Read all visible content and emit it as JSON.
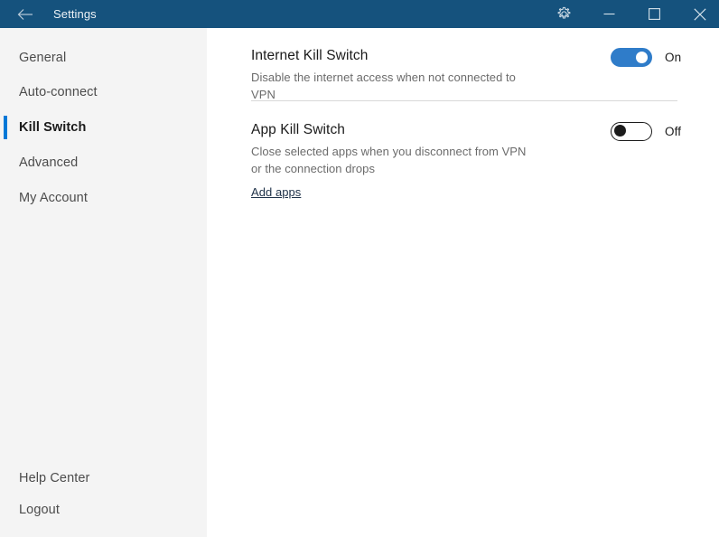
{
  "titlebar": {
    "title": "Settings",
    "back_icon": "back-arrow-icon",
    "gear_icon": "gear-icon",
    "minimize_icon": "minimize-icon",
    "maximize_icon": "maximize-icon",
    "close_icon": "close-icon",
    "background_color": "#15527d"
  },
  "sidebar": {
    "background_color": "#f4f4f4",
    "accent_color": "#0078d7",
    "items": [
      {
        "label": "General",
        "selected": false
      },
      {
        "label": "Auto-connect",
        "selected": false
      },
      {
        "label": "Kill Switch",
        "selected": true
      },
      {
        "label": "Advanced",
        "selected": false
      },
      {
        "label": "My Account",
        "selected": false
      }
    ],
    "bottom_items": [
      {
        "label": "Help Center"
      },
      {
        "label": "Logout"
      }
    ]
  },
  "main": {
    "settings": [
      {
        "title": "Internet Kill Switch",
        "description": "Disable the internet access when not connected to VPN",
        "toggle_state": "on",
        "toggle_label": "On"
      },
      {
        "title": "App Kill Switch",
        "description": "Close selected apps when you disconnect from VPN or the connection drops",
        "toggle_state": "off",
        "toggle_label": "Off"
      }
    ],
    "add_apps_link": "Add apps"
  }
}
